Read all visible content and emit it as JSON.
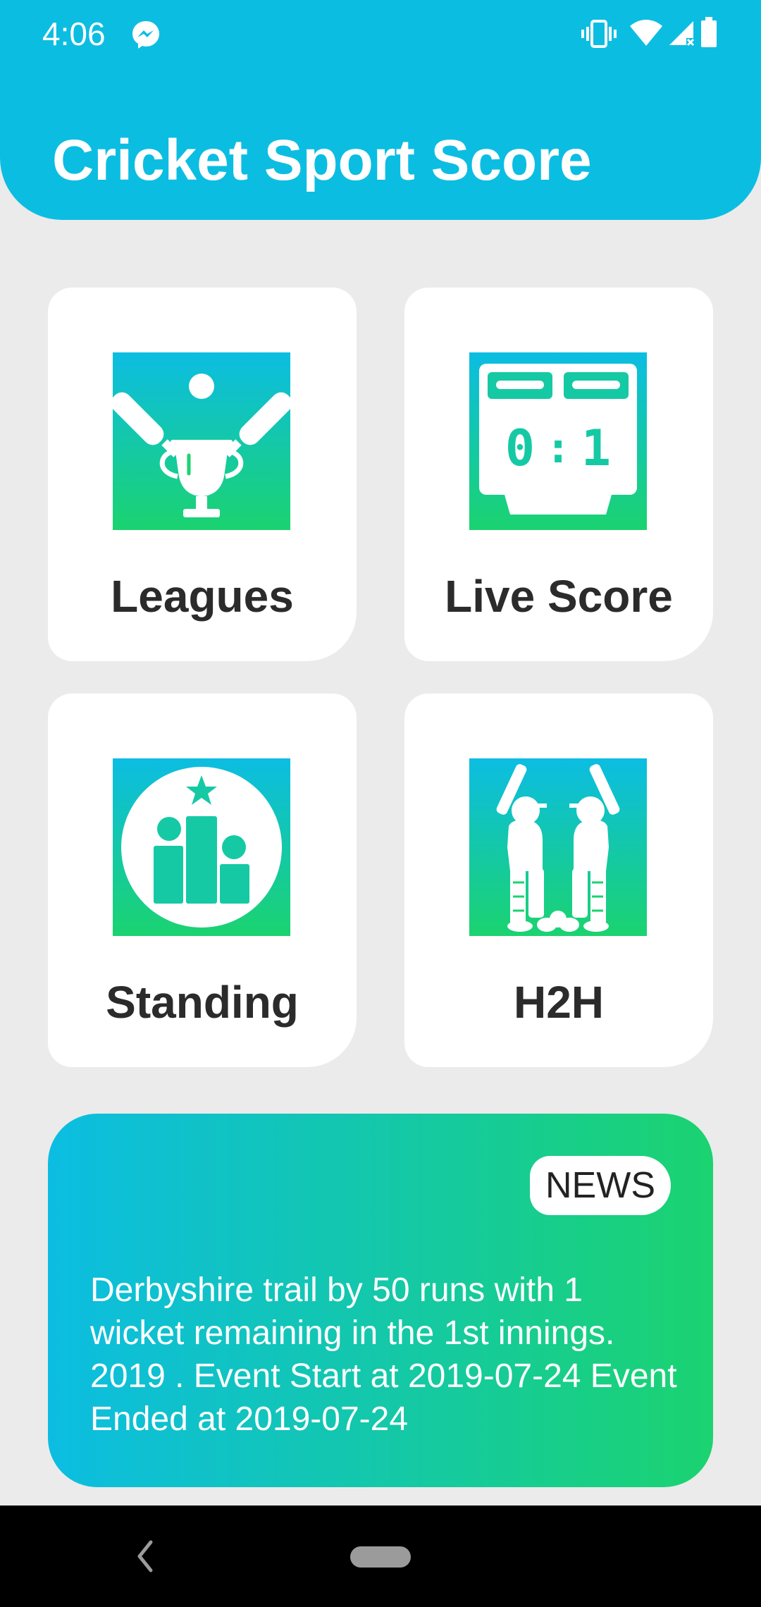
{
  "status_bar": {
    "time": "4:06",
    "icons": [
      "messenger-icon",
      "vibrate-icon",
      "wifi-icon",
      "signal-icon",
      "battery-icon"
    ]
  },
  "header": {
    "title": "Cricket Sport Score"
  },
  "menu": {
    "items": [
      {
        "label": "Leagues",
        "icon": "trophy-bats-icon"
      },
      {
        "label": "Live Score",
        "icon": "scoreboard-icon",
        "score_left": "0",
        "score_sep": ":",
        "score_right": "1"
      },
      {
        "label": "Standing",
        "icon": "podium-icon"
      },
      {
        "label": "H2H",
        "icon": "batsmen-icon"
      }
    ]
  },
  "news": {
    "badge": "NEWS",
    "text": "Derbyshire trail by 50 runs with 1 wicket remaining in the 1st innings. 2019 . Event Start at 2019-07-24 Event Ended at 2019-07-24"
  },
  "colors": {
    "header": "#0cbde2",
    "gradient_top": "#0cbde2",
    "gradient_bottom": "#1bd370",
    "background": "#ebebeb"
  }
}
